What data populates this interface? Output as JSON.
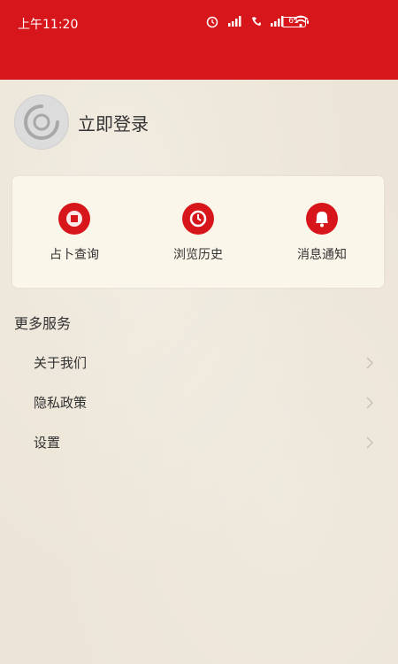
{
  "status_bar": {
    "time": "上午11:20",
    "battery": "61"
  },
  "profile": {
    "login_label": "立即登录"
  },
  "quick_actions": [
    {
      "label": "占卜查询",
      "icon": "coin-icon"
    },
    {
      "label": "浏览历史",
      "icon": "clock-icon"
    },
    {
      "label": "消息通知",
      "icon": "bell-icon"
    }
  ],
  "more_services": {
    "title": "更多服务",
    "items": [
      {
        "label": "关于我们"
      },
      {
        "label": "隐私政策"
      },
      {
        "label": "设置"
      }
    ]
  },
  "colors": {
    "brand_red": "#d7161b",
    "card_bg": "#fbf6ea"
  }
}
